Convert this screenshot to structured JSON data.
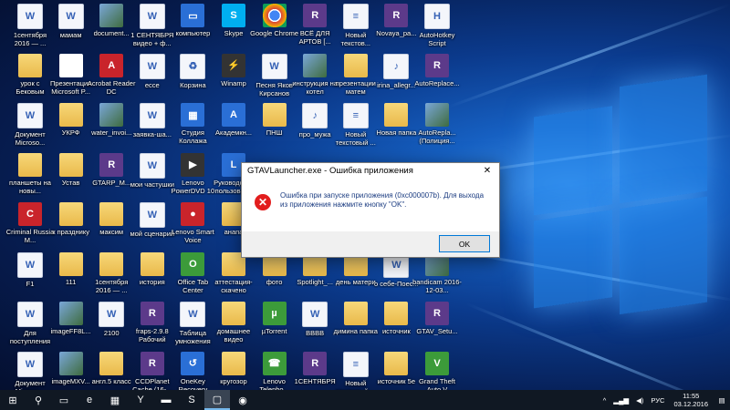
{
  "desktop": {
    "columns": [
      [
        {
          "label": "1сентября 2016 — ...",
          "icon": "word-doc-icon",
          "kind": "g-doc",
          "glyph": "W"
        },
        {
          "label": "урок с Бековым",
          "icon": "folder-icon",
          "kind": "g-folder",
          "glyph": ""
        },
        {
          "label": "Документ Microso...",
          "icon": "word-doc-icon",
          "kind": "g-doc",
          "glyph": "W"
        },
        {
          "label": "планшеты на новы...",
          "icon": "folder-icon",
          "kind": "g-folder",
          "glyph": ""
        },
        {
          "label": "Criminal Russia M...",
          "icon": "game-icon",
          "kind": "g-red",
          "glyph": "C"
        },
        {
          "label": "F1",
          "icon": "word-doc-icon",
          "kind": "g-doc",
          "glyph": "W"
        },
        {
          "label": "Для поступления",
          "icon": "word-doc-icon",
          "kind": "g-doc",
          "glyph": "W"
        },
        {
          "label": "Документ Microso...",
          "icon": "word-doc-icon",
          "kind": "g-doc",
          "glyph": "W"
        }
      ],
      [
        {
          "label": "мамам",
          "icon": "word-doc-icon",
          "kind": "g-doc",
          "glyph": "W"
        },
        {
          "label": "Презентация Microsoft P...",
          "icon": "powerpoint-icon",
          "kind": "g-white",
          "glyph": ""
        },
        {
          "label": "УКРФ",
          "icon": "folder-icon",
          "kind": "g-folder",
          "glyph": ""
        },
        {
          "label": "Устав",
          "icon": "folder-icon",
          "kind": "g-folder",
          "glyph": ""
        },
        {
          "label": "к празднику",
          "icon": "folder-icon",
          "kind": "g-folder",
          "glyph": ""
        },
        {
          "label": "111",
          "icon": "folder-icon",
          "kind": "g-folder",
          "glyph": ""
        },
        {
          "label": "imageFF8L...",
          "icon": "image-icon",
          "kind": "g-img",
          "glyph": ""
        },
        {
          "label": "imageMXV...",
          "icon": "image-icon",
          "kind": "g-img",
          "glyph": ""
        }
      ],
      [
        {
          "label": "document...",
          "icon": "image-icon",
          "kind": "g-img",
          "glyph": ""
        },
        {
          "label": "Acrobat Reader DC",
          "icon": "acrobat-icon",
          "kind": "g-red",
          "glyph": "A"
        },
        {
          "label": "water_invoi...",
          "icon": "image-icon",
          "kind": "g-img",
          "glyph": ""
        },
        {
          "label": "GTARP_M...",
          "icon": "archive-icon",
          "kind": "g-win",
          "glyph": "R"
        },
        {
          "label": "максим",
          "icon": "folder-icon",
          "kind": "g-folder",
          "glyph": ""
        },
        {
          "label": "1сентября 2016 — ...",
          "icon": "folder-icon",
          "kind": "g-folder",
          "glyph": ""
        },
        {
          "label": "2100",
          "icon": "word-doc-icon",
          "kind": "g-doc",
          "glyph": "W"
        },
        {
          "label": "англ.5 класс",
          "icon": "folder-icon",
          "kind": "g-folder",
          "glyph": ""
        }
      ],
      [
        {
          "label": "1 СЕНТЯБРЯ видео + ф...",
          "icon": "word-doc-icon",
          "kind": "g-doc",
          "glyph": "W"
        },
        {
          "label": "ессе",
          "icon": "word-doc-icon",
          "kind": "g-doc",
          "glyph": "W"
        },
        {
          "label": "заявка-ша...",
          "icon": "word-doc-icon",
          "kind": "g-doc",
          "glyph": "W"
        },
        {
          "label": "мои частушки",
          "icon": "word-doc-icon",
          "kind": "g-doc",
          "glyph": "W"
        },
        {
          "label": "мой сценарий",
          "icon": "word-doc-icon",
          "kind": "g-doc",
          "glyph": "W"
        },
        {
          "label": "история",
          "icon": "folder-icon",
          "kind": "g-folder",
          "glyph": ""
        },
        {
          "label": "fraps-2.9.8 Рабочий",
          "icon": "archive-icon",
          "kind": "g-win",
          "glyph": "R"
        },
        {
          "label": "CCDPlanet Cache (16-...",
          "icon": "archive-icon",
          "kind": "g-win",
          "glyph": "R"
        }
      ],
      [
        {
          "label": "компьютер",
          "icon": "computer-icon",
          "kind": "g-app",
          "glyph": "▭"
        },
        {
          "label": "Корзина",
          "icon": "recycle-bin-icon",
          "kind": "g-doc",
          "glyph": "♻"
        },
        {
          "label": "Студия Коллажа",
          "icon": "collage-app-icon",
          "kind": "g-app",
          "glyph": "▦"
        },
        {
          "label": "Lenovo PowerDVD 10",
          "icon": "powerdvd-icon",
          "kind": "g-dark",
          "glyph": "▶"
        },
        {
          "label": "Lenovo Smart Voice",
          "icon": "smart-voice-icon",
          "kind": "g-red",
          "glyph": "●"
        },
        {
          "label": "Office Tab Center",
          "icon": "office-tab-icon",
          "kind": "g-green",
          "glyph": "O"
        },
        {
          "label": "Таблица умножения",
          "icon": "word-doc-icon",
          "kind": "g-doc",
          "glyph": "W"
        },
        {
          "label": "OneKey Recovery",
          "icon": "onekey-icon",
          "kind": "g-app",
          "glyph": "↺"
        }
      ],
      [
        {
          "label": "Skype",
          "icon": "skype-icon",
          "kind": "g-skype",
          "glyph": "S"
        },
        {
          "label": "Winamp",
          "icon": "winamp-icon",
          "kind": "g-dark",
          "glyph": "⚡"
        },
        {
          "label": "Академкн...",
          "icon": "app-icon",
          "kind": "g-app",
          "glyph": "A"
        },
        {
          "label": "Руководства пользоват...",
          "icon": "lenovo-guide-icon",
          "kind": "g-app",
          "glyph": "L"
        },
        {
          "label": "анапа",
          "icon": "folder-icon",
          "kind": "g-folder",
          "glyph": ""
        },
        {
          "label": "аттестация-скачено",
          "icon": "folder-icon",
          "kind": "g-folder",
          "glyph": ""
        },
        {
          "label": "домашнее видео",
          "icon": "folder-icon",
          "kind": "g-folder",
          "glyph": ""
        },
        {
          "label": "кругозор",
          "icon": "folder-icon",
          "kind": "g-folder",
          "glyph": ""
        }
      ],
      [
        {
          "label": "Google Chrome",
          "icon": "chrome-icon",
          "kind": "g-chrome",
          "glyph": ""
        },
        {
          "label": "Песня Яков Кирсанов",
          "icon": "word-doc-icon",
          "kind": "g-doc",
          "glyph": "W"
        },
        {
          "label": "ПНШ",
          "icon": "folder-icon",
          "kind": "g-folder",
          "glyph": ""
        },
        {
          "label": "",
          "icon": "",
          "kind": "",
          "glyph": ""
        },
        {
          "label": "",
          "icon": "",
          "kind": "",
          "glyph": ""
        },
        {
          "label": "фото",
          "icon": "folder-icon",
          "kind": "g-folder",
          "glyph": ""
        },
        {
          "label": "µTorrent",
          "icon": "utorrent-icon",
          "kind": "g-green",
          "glyph": "µ"
        },
        {
          "label": "Lenovo Telepho...",
          "icon": "lenovo-phone-icon",
          "kind": "g-green",
          "glyph": "☎"
        }
      ],
      [
        {
          "label": "ВСЁ ДЛЯ АРТОВ [...",
          "icon": "archive-icon",
          "kind": "g-win",
          "glyph": "R"
        },
        {
          "label": "инструкция на котел",
          "icon": "image-icon",
          "kind": "g-img",
          "glyph": ""
        },
        {
          "label": "про_мужа",
          "icon": "mp3-icon",
          "kind": "g-doc",
          "glyph": "♪"
        },
        {
          "label": "",
          "icon": "",
          "kind": "",
          "glyph": ""
        },
        {
          "label": "",
          "icon": "",
          "kind": "",
          "glyph": ""
        },
        {
          "label": "Spotlight_...",
          "icon": "folder-icon",
          "kind": "g-folder",
          "glyph": ""
        },
        {
          "label": "BBBB",
          "icon": "word-doc-icon",
          "kind": "g-doc",
          "glyph": "W"
        },
        {
          "label": "1СЕНТЯБРЯ",
          "icon": "archive-icon",
          "kind": "g-win",
          "glyph": "R"
        }
      ],
      [
        {
          "label": "Новый текстов...",
          "icon": "text-file-icon",
          "kind": "g-doc",
          "glyph": "≡"
        },
        {
          "label": "презентации матем",
          "icon": "folder-icon",
          "kind": "g-folder",
          "glyph": ""
        },
        {
          "label": "Новый текстовый ...",
          "icon": "text-file-icon",
          "kind": "g-doc",
          "glyph": "≡"
        },
        {
          "label": "",
          "icon": "",
          "kind": "",
          "glyph": ""
        },
        {
          "label": "",
          "icon": "",
          "kind": "",
          "glyph": ""
        },
        {
          "label": "день матери",
          "icon": "folder-icon",
          "kind": "g-folder",
          "glyph": ""
        },
        {
          "label": "димина папка",
          "icon": "folder-icon",
          "kind": "g-folder",
          "glyph": ""
        },
        {
          "label": "Новый текстовый ...",
          "icon": "text-file-icon",
          "kind": "g-doc",
          "glyph": "≡"
        }
      ],
      [
        {
          "label": "Novaya_pa...",
          "icon": "archive-icon",
          "kind": "g-win",
          "glyph": "R"
        },
        {
          "label": "irina_allegr...",
          "icon": "mp3-icon",
          "kind": "g-doc",
          "glyph": "♪"
        },
        {
          "label": "Новая папка",
          "icon": "folder-icon",
          "kind": "g-folder",
          "glyph": ""
        },
        {
          "label": "",
          "icon": "",
          "kind": "",
          "glyph": ""
        },
        {
          "label": "",
          "icon": "",
          "kind": "",
          "glyph": ""
        },
        {
          "label": "о себе-Поеc...",
          "icon": "word-doc-icon",
          "kind": "g-doc",
          "glyph": "W"
        },
        {
          "label": "источник",
          "icon": "folder-icon",
          "kind": "g-folder",
          "glyph": ""
        },
        {
          "label": "источник 5е",
          "icon": "folder-icon",
          "kind": "g-folder",
          "glyph": ""
        }
      ],
      [
        {
          "label": "AutoHotkey Script",
          "icon": "autohotkey-icon",
          "kind": "g-doc",
          "glyph": "H"
        },
        {
          "label": "AutoReplace...",
          "icon": "archive-icon",
          "kind": "g-win",
          "glyph": "R"
        },
        {
          "label": "AutoRepla... (Полиция...",
          "icon": "image-icon",
          "kind": "g-img",
          "glyph": ""
        },
        {
          "label": "",
          "icon": "",
          "kind": "",
          "glyph": ""
        },
        {
          "label": "",
          "icon": "",
          "kind": "",
          "glyph": ""
        },
        {
          "label": "bandicam 2016-12-03...",
          "icon": "video-icon",
          "kind": "g-img",
          "glyph": ""
        },
        {
          "label": "GTAV_Setu...",
          "icon": "archive-icon",
          "kind": "g-win",
          "glyph": "R"
        },
        {
          "label": "Grand Theft Auto V",
          "icon": "gtav-icon",
          "kind": "g-green",
          "glyph": "V"
        }
      ]
    ]
  },
  "dialog": {
    "title": "GTAVLauncher.exe - Ошибка приложения",
    "close_glyph": "✕",
    "message": "Ошибка при запуске приложения (0xc000007b). Для выхода из приложения нажмите кнопку \"OK\".",
    "ok_label": "OK",
    "icon_glyph": "✕"
  },
  "taskbar": {
    "items": [
      {
        "name": "start-button",
        "glyph": "⊞"
      },
      {
        "name": "search-icon",
        "glyph": "⚲"
      },
      {
        "name": "task-view-icon",
        "glyph": "▭"
      },
      {
        "name": "edge-icon",
        "glyph": "e"
      },
      {
        "name": "control-panel-icon",
        "glyph": "▦"
      },
      {
        "name": "yandex-browser-icon",
        "glyph": "Y"
      },
      {
        "name": "file-explorer-icon",
        "glyph": "▬"
      },
      {
        "name": "skype-taskbar-icon",
        "glyph": "S"
      },
      {
        "name": "error-window-taskbar-icon",
        "glyph": "▢",
        "active": true
      },
      {
        "name": "app-taskbar-icon",
        "glyph": "◉"
      }
    ],
    "tray": {
      "up_arrow": "^",
      "network": "▂▄▆",
      "volume": "◀)",
      "language": "РУС",
      "time": "11:55",
      "date": "03.12.2016",
      "notifications": "▤"
    }
  }
}
